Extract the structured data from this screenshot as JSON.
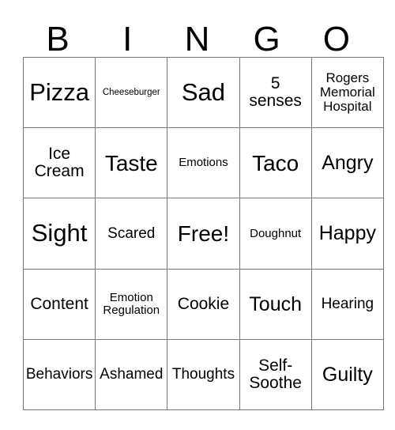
{
  "card": {
    "title": "BINGO",
    "headers": [
      "B",
      "I",
      "N",
      "G",
      "O"
    ],
    "rows": [
      [
        {
          "text": "Pizza",
          "size": "fs-xxl"
        },
        {
          "text": "Cheeseburger",
          "size": "fs-xxs"
        },
        {
          "text": "Sad",
          "size": "fs-xxl"
        },
        {
          "text": "5\nsenses",
          "size": "fs-m"
        },
        {
          "text": "Rogers\nMemorial\nHospital",
          "size": "fs-s"
        }
      ],
      [
        {
          "text": "Ice\nCream",
          "size": "fs-m"
        },
        {
          "text": "Taste",
          "size": "fs-xl"
        },
        {
          "text": "Emotions",
          "size": "fs-xs"
        },
        {
          "text": "Taco",
          "size": "fs-xl"
        },
        {
          "text": "Angry",
          "size": "fs-l"
        }
      ],
      [
        {
          "text": "Sight",
          "size": "fs-xxl"
        },
        {
          "text": "Scared",
          "size": "fs-ms"
        },
        {
          "text": "Free!",
          "size": "fs-xl"
        },
        {
          "text": "Doughnut",
          "size": "fs-xs"
        },
        {
          "text": "Happy",
          "size": "fs-l"
        }
      ],
      [
        {
          "text": "Content",
          "size": "fs-m"
        },
        {
          "text": "Emotion\nRegulation",
          "size": "fs-xs"
        },
        {
          "text": "Cookie",
          "size": "fs-m"
        },
        {
          "text": "Touch",
          "size": "fs-l"
        },
        {
          "text": "Hearing",
          "size": "fs-ms"
        }
      ],
      [
        {
          "text": "Behaviors",
          "size": "fs-ms"
        },
        {
          "text": "Ashamed",
          "size": "fs-ms"
        },
        {
          "text": "Thoughts",
          "size": "fs-ms"
        },
        {
          "text": "Self-\nSoothe",
          "size": "fs-m"
        },
        {
          "text": "Guilty",
          "size": "fs-l"
        }
      ]
    ]
  },
  "colors": {
    "background": "#ffffff",
    "text": "#000000",
    "gridline": "#787878"
  }
}
